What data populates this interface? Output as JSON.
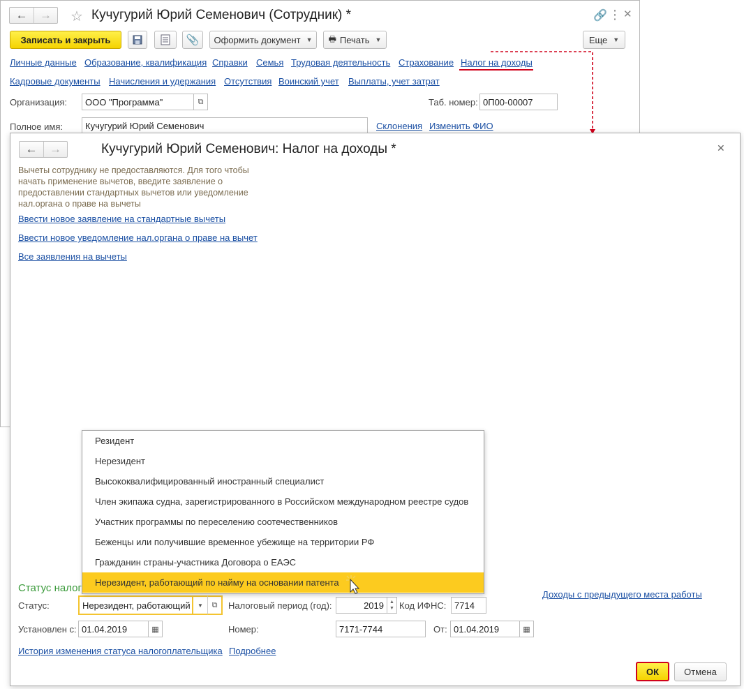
{
  "employee_window": {
    "title": "Кучугурий Юрий Семенович (Сотрудник) *",
    "toolbar": {
      "save_close": "Записать и закрыть",
      "issue_document": "Оформить документ",
      "print": "Печать",
      "more": "Еще"
    },
    "links_row1": [
      "Личные данные",
      "Образование, квалификация",
      "Справки",
      "Семья",
      "Трудовая деятельность",
      "Страхование",
      "Налог на доходы"
    ],
    "links_row2": [
      "Кадровые документы",
      "Начисления и удержания",
      "Отсутствия",
      "Воинский учет",
      "Выплаты, учет затрат"
    ],
    "organization_label": "Организация:",
    "organization_value": "ООО \"Программа\"",
    "tab_number_label": "Таб. номер:",
    "tab_number_value": "0П00-00007",
    "full_name_label": "Полное имя:",
    "full_name_value": "Кучугурий Юрий Семенович",
    "declensions_link": "Склонения",
    "change_name_link": "Изменить ФИО"
  },
  "tax_window": {
    "title": "Кучугурий Юрий Семенович: Налог на доходы *",
    "hint": "Вычеты сотруднику не предоставляются. Для того чтобы начать применение вычетов, введите заявление о предоставлении стандартных вычетов или уведомление нал.органа о праве на вычеты",
    "link_new_application": "Ввести новое заявление на стандартные вычеты",
    "link_new_notice": "Ввести новое уведомление нал.органа о праве на вычет",
    "link_all_applications": "Все заявления на вычеты",
    "status_section": "Статус налог",
    "status_label": "Статус:",
    "status_value": "Нерезидент, работающий",
    "tax_period_label": "Налоговый период (год):",
    "tax_period_value": "2019",
    "ifns_label": "Код ИФНС:",
    "ifns_value": "7714",
    "installed_label": "Установлен с:",
    "installed_value": "01.04.2019",
    "number_label": "Номер:",
    "number_value": "7171-7744",
    "from_label": "От:",
    "from_value": "01.04.2019",
    "link_prev_income": "Доходы с предыдущего места работы",
    "link_history": "История изменения статуса налогоплательщика",
    "link_more": "Подробнее",
    "ok": "ОК",
    "cancel": "Отмена"
  },
  "status_dropdown": {
    "options": [
      "Резидент",
      "Нерезидент",
      "Высококвалифицированный иностранный специалист",
      "Член экипажа судна, зарегистрированного в Российском международном реестре судов",
      "Участник программы по переселению соотечественников",
      "Беженцы или получившие временное убежище на территории РФ",
      "Гражданин страны-участника Договора о ЕАЭС",
      "Нерезидент, работающий по найму на основании патента"
    ],
    "selected_index": 7
  },
  "colors": {
    "primary_button": "#f5d300",
    "link": "#1a4fa3",
    "highlight": "#fccb1f",
    "annotation": "#d0021b",
    "section_title": "#3a9a3a"
  }
}
